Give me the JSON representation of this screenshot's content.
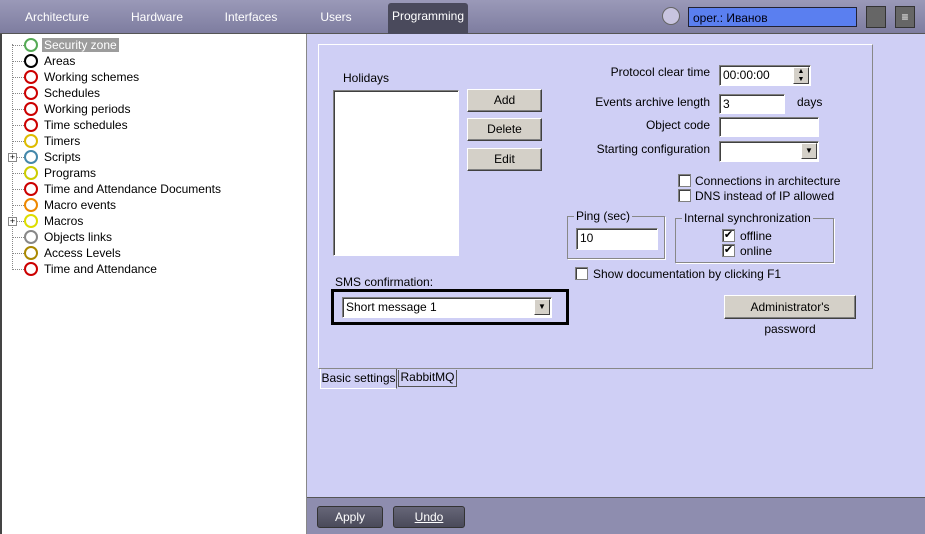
{
  "topbar": {
    "tabs": [
      "Architecture",
      "Hardware",
      "Interfaces",
      "Users",
      "Programming"
    ],
    "active": "Programming",
    "operator": "oper.: Иванов"
  },
  "tree": {
    "items": [
      "Security zone",
      "Areas",
      "Working schemes",
      "Schedules",
      "Working periods",
      "Time schedules",
      "Timers",
      "Scripts",
      "Programs",
      "Time and Attendance Documents",
      "Macro events",
      "Macros",
      "Objects links",
      "Access Levels",
      "Time and Attendance"
    ],
    "selected": "Security zone"
  },
  "settings": {
    "holidays_label": "Holidays",
    "add": "Add",
    "delete": "Delete",
    "edit": "Edit",
    "protocol_clear_time_label": "Protocol clear time",
    "protocol_clear_time": "00:00:00",
    "events_archive_label": "Events archive length",
    "events_archive": "3",
    "days": "days",
    "object_code_label": "Object code",
    "object_code": "",
    "starting_config_label": "Starting configuration",
    "starting_config": "",
    "connections_arch": "Connections in architecture",
    "dns_instead": "DNS instead of IP allowed",
    "ping_label": "Ping (sec)",
    "ping": "10",
    "sync_label": "Internal synchronization",
    "offline": "offline",
    "online": "online",
    "show_doc": "Show documentation by clicking F1",
    "sms_label": "SMS confirmation:",
    "sms_value": "Short message 1",
    "admin_password": "Administrator's password",
    "check": "✔"
  },
  "tabs": [
    "Basic settings",
    "RabbitMQ"
  ],
  "bottom": {
    "apply": "Apply",
    "undo": "Undo"
  }
}
